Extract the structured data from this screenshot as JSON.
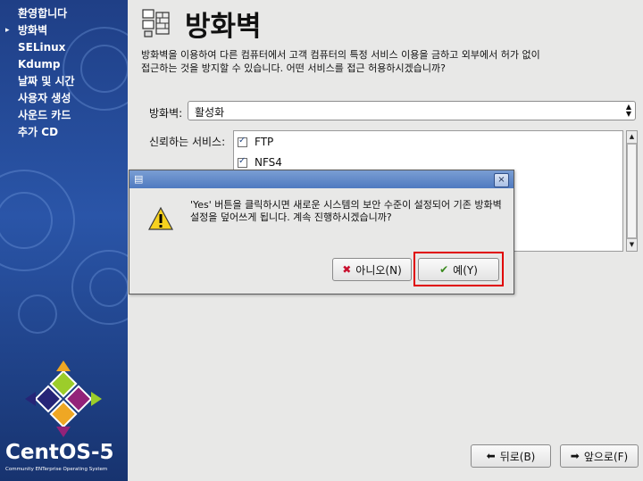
{
  "sidebar": {
    "items": [
      {
        "label": "환영합니다",
        "current": false
      },
      {
        "label": "방화벽",
        "current": true
      },
      {
        "label": "SELinux",
        "current": false
      },
      {
        "label": "Kdump",
        "current": false
      },
      {
        "label": "날짜 및 시간",
        "current": false
      },
      {
        "label": "사용자 생성",
        "current": false
      },
      {
        "label": "사운드 카드",
        "current": false
      },
      {
        "label": "추가 CD",
        "current": false
      }
    ],
    "current_marker": "▸",
    "logo": {
      "text": "CentOS-5",
      "subtitle": "Community ENTerprise Operating System"
    }
  },
  "main": {
    "title": "방화벽",
    "description": "방화벽을 이용하여 다른 컴퓨터에서 고객 컴퓨터의 특정 서비스 이용을 금하고 외부에서 허가 없이 접근하는 것을 방지할 수 있습니다. 어떤 서비스를 접근 허용하시겠습니까?",
    "firewall_label": "방화벽:",
    "firewall_value": "활성화",
    "services_label": "신뢰하는 서비스:",
    "services": [
      {
        "name": "FTP",
        "checked": true
      },
      {
        "name": "NFS4",
        "checked": true
      }
    ]
  },
  "dialog": {
    "message": "'Yes' 버튼을 클릭하시면 새로운 시스템의 보안 수준이 설정되어 기존 방화벽 설정을 덮어쓰게 됩니다. 계속 진행하시겠습니까?",
    "no_label": "아니오(N)",
    "yes_label": "예(Y)",
    "close_icon": "×"
  },
  "footer": {
    "back_label": "뒤로(B)",
    "forward_label": "앞으로(F)"
  },
  "colors": {
    "sidebar": "#2a55a8",
    "highlight": "#e00000",
    "dialog_titlebar": "#5f88c9"
  }
}
